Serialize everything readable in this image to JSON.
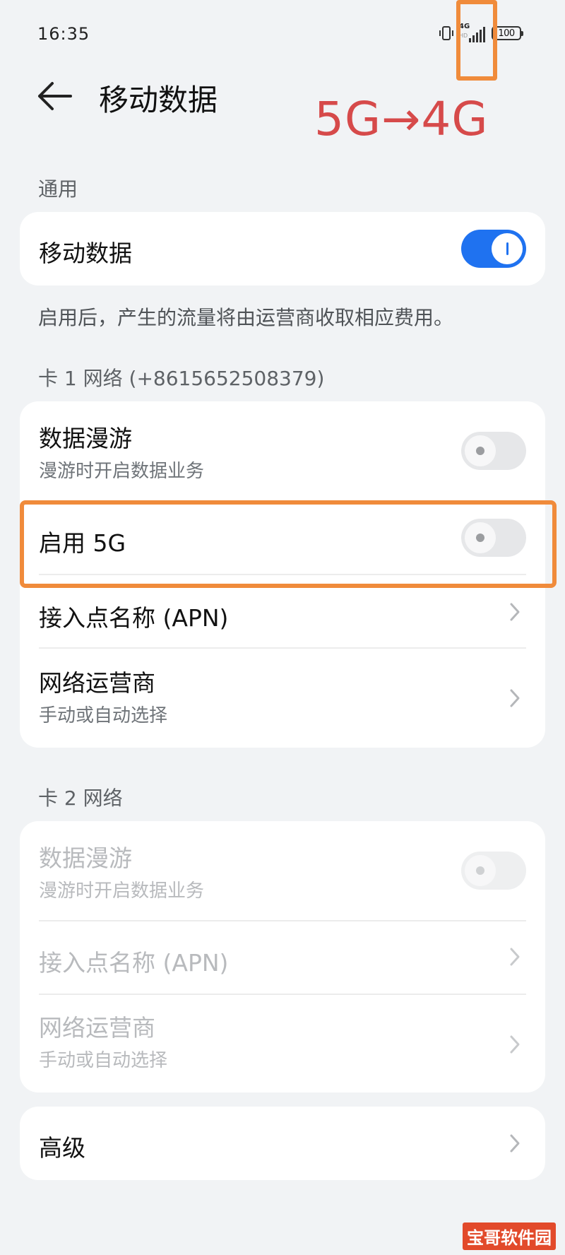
{
  "status_bar": {
    "time": "16:35",
    "network": "4G",
    "battery": "100"
  },
  "header": {
    "title": "移动数据"
  },
  "annotation": {
    "text": "5G→4G"
  },
  "general": {
    "section_label": "通用",
    "mobile_data": {
      "title": "移动数据",
      "enabled": true
    },
    "note": "启用后，产生的流量将由运营商收取相应费用。"
  },
  "card1": {
    "section_label": "卡 1 网络 (+8615652508379)",
    "roaming": {
      "title": "数据漫游",
      "subtitle": "漫游时开启数据业务",
      "enabled": false
    },
    "enable_5g": {
      "title": "启用 5G",
      "enabled": false
    },
    "apn": {
      "title": "接入点名称 (APN)"
    },
    "carrier": {
      "title": "网络运营商",
      "subtitle": "手动或自动选择"
    }
  },
  "card2": {
    "section_label": "卡 2 网络",
    "roaming": {
      "title": "数据漫游",
      "subtitle": "漫游时开启数据业务",
      "enabled": false
    },
    "apn": {
      "title": "接入点名称 (APN)"
    },
    "carrier": {
      "title": "网络运营商",
      "subtitle": "手动或自动选择"
    }
  },
  "advanced": {
    "title": "高级"
  },
  "watermark": {
    "text": "宝哥软件园"
  },
  "colors": {
    "accent": "#1f72f0",
    "annotation_red": "#d64a4a",
    "annotation_orange": "#f08b3b"
  }
}
